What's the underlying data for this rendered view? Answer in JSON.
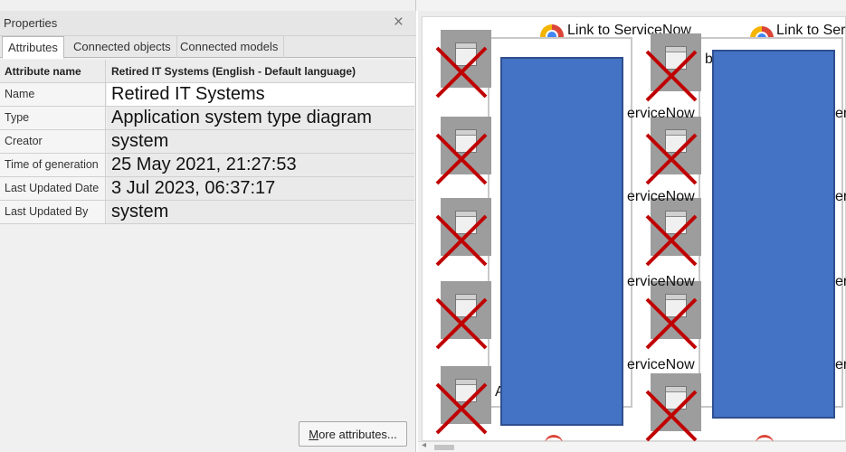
{
  "panel": {
    "title": "Properties",
    "close_glyph": "×",
    "tabs": [
      {
        "label": "Attributes",
        "active": true
      },
      {
        "label": "Connected objects",
        "active": false
      },
      {
        "label": "Connected models",
        "active": false
      }
    ],
    "table": {
      "header": {
        "col1": "Attribute name",
        "col2": "Retired IT Systems (English - Default language)"
      },
      "rows": [
        {
          "name": "Name",
          "value": "Retired IT Systems"
        },
        {
          "name": "Type",
          "value": "Application system type diagram"
        },
        {
          "name": "Creator",
          "value": "system"
        },
        {
          "name": "Time of generation",
          "value": "25 May 2021, 21:27:53"
        },
        {
          "name": "Last Updated Date",
          "value": "3 Jul 2023, 06:37:17"
        },
        {
          "name": "Last Updated By",
          "value": "system"
        }
      ]
    },
    "more_button": {
      "accel": "M",
      "rest": "ore attributes..."
    }
  },
  "canvas": {
    "link_label_1": "Link to ServiceNow",
    "link_label_2": "Link to Ser",
    "fragment_b": "b",
    "fragment_servicenow": "erviceNow",
    "fragment_er": "er",
    "fragment_a": "A",
    "accent_blue": "#4472c4",
    "cross_red": "#c00000",
    "icons": [
      "chrome-icon",
      "application-window-icon",
      "red-cross-icon"
    ]
  }
}
